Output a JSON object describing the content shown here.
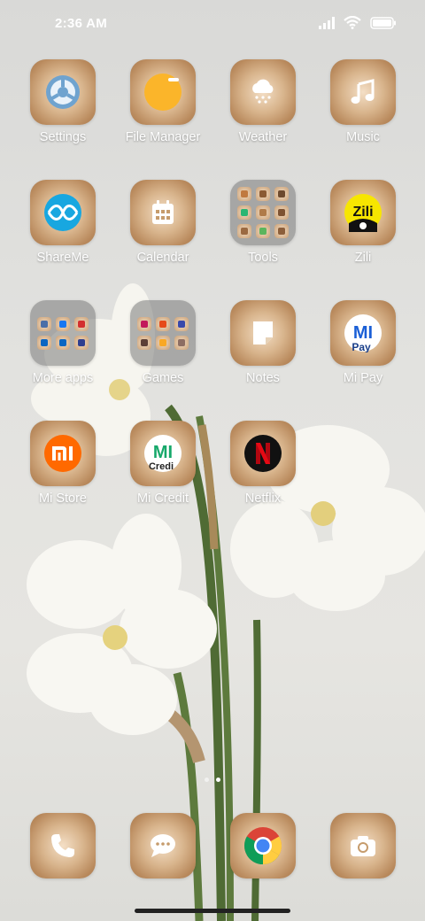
{
  "status_bar": {
    "time": "2:36 AM"
  },
  "apps": [
    {
      "label": "Settings",
      "icon": "settings-icon"
    },
    {
      "label": "File Manager",
      "icon": "file-manager-icon"
    },
    {
      "label": "Weather",
      "icon": "weather-icon"
    },
    {
      "label": "Music",
      "icon": "music-icon"
    },
    {
      "label": "ShareMe",
      "icon": "shareme-icon"
    },
    {
      "label": "Calendar",
      "icon": "calendar-icon"
    },
    {
      "label": "Tools",
      "icon": "tools-folder-icon"
    },
    {
      "label": "Zili",
      "icon": "zili-icon"
    },
    {
      "label": "More apps",
      "icon": "more-apps-folder-icon"
    },
    {
      "label": "Games",
      "icon": "games-folder-icon"
    },
    {
      "label": "Notes",
      "icon": "notes-icon"
    },
    {
      "label": "Mi Pay",
      "icon": "mi-pay-icon"
    },
    {
      "label": "Mi Store",
      "icon": "mi-store-icon"
    },
    {
      "label": "Mi Credit",
      "icon": "mi-credit-icon"
    },
    {
      "label": "Netflix",
      "icon": "netflix-icon"
    }
  ],
  "dock": [
    {
      "icon": "phone-icon"
    },
    {
      "icon": "messages-icon"
    },
    {
      "icon": "chrome-icon"
    },
    {
      "icon": "camera-icon"
    }
  ],
  "icon_text": {
    "zili": "Zili",
    "mi_pay_top": "MI",
    "mi_pay_bottom": "Pay",
    "mi_credit_top": "MI",
    "mi_credit_bottom": "Credi"
  },
  "page_indicator": {
    "pages": 2,
    "active": 2
  },
  "colors": {
    "label": "#ffffff",
    "icon_wood": "#d8b48c",
    "folder": "#7a7a7a",
    "mi_orange": "#ff6900",
    "netflix_red": "#e50914"
  }
}
